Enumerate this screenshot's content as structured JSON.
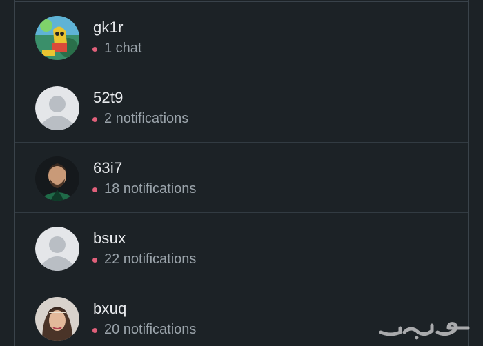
{
  "colors": {
    "background": "#1c2226",
    "divider": "#323b42",
    "name_text": "#e8eaed",
    "status_text": "#9aa3aa",
    "status_dot": "#e0607a"
  },
  "list": {
    "items": [
      {
        "name": "gk1r",
        "status": "1 chat",
        "avatar": "photo-cartoon"
      },
      {
        "name": "52t9",
        "status": "2 notifications",
        "avatar": "default-person-icon"
      },
      {
        "name": "63i7",
        "status": "18 notifications",
        "avatar": "photo-man"
      },
      {
        "name": "bsux",
        "status": "22 notifications",
        "avatar": "default-person-icon"
      },
      {
        "name": "bxuq",
        "status": "20 notifications",
        "avatar": "photo-woman"
      }
    ]
  },
  "watermark": {
    "text": "حراج"
  }
}
